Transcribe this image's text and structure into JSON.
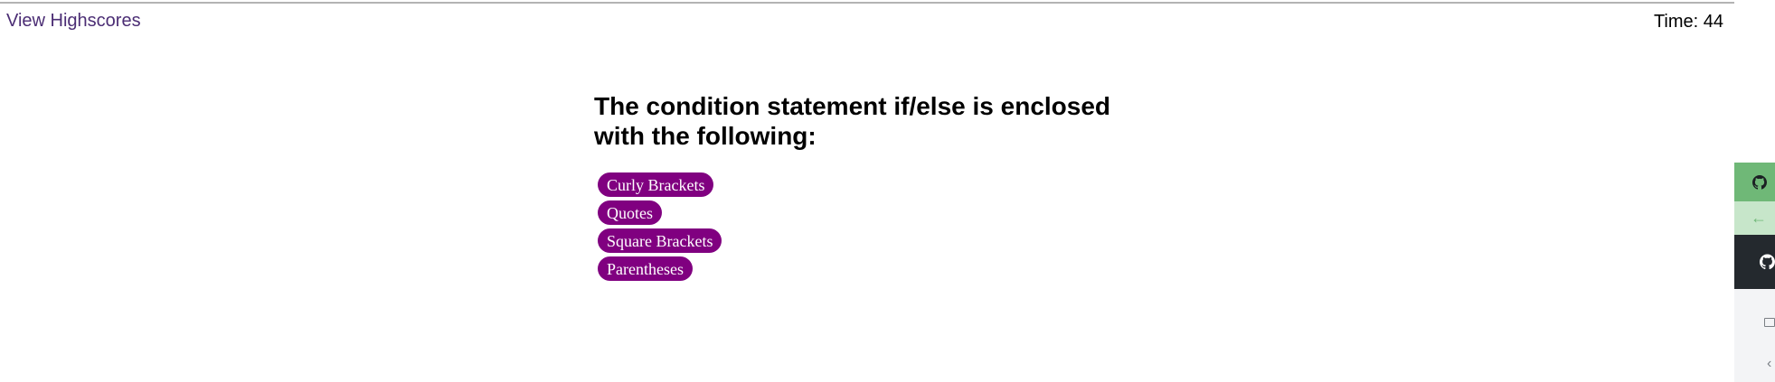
{
  "header": {
    "highscores_link": "View Highscores",
    "timer_label": "Time: 44"
  },
  "quiz": {
    "question": "The condition statement if/else is enclosed with the following:",
    "answers": [
      "Curly Brackets",
      "Quotes",
      "Square Brackets",
      "Parentheses"
    ]
  },
  "side_widget": {
    "icons": [
      "github-icon",
      "arrow-left-icon",
      "github-logo-icon",
      "monitor-icon",
      "chevron-left-icon"
    ]
  },
  "colors": {
    "link": "#4b2d74",
    "answer_button_bg": "#800080",
    "answer_button_text": "#ffffff",
    "widget_green": "#6fb877",
    "widget_dark": "#24292e"
  }
}
